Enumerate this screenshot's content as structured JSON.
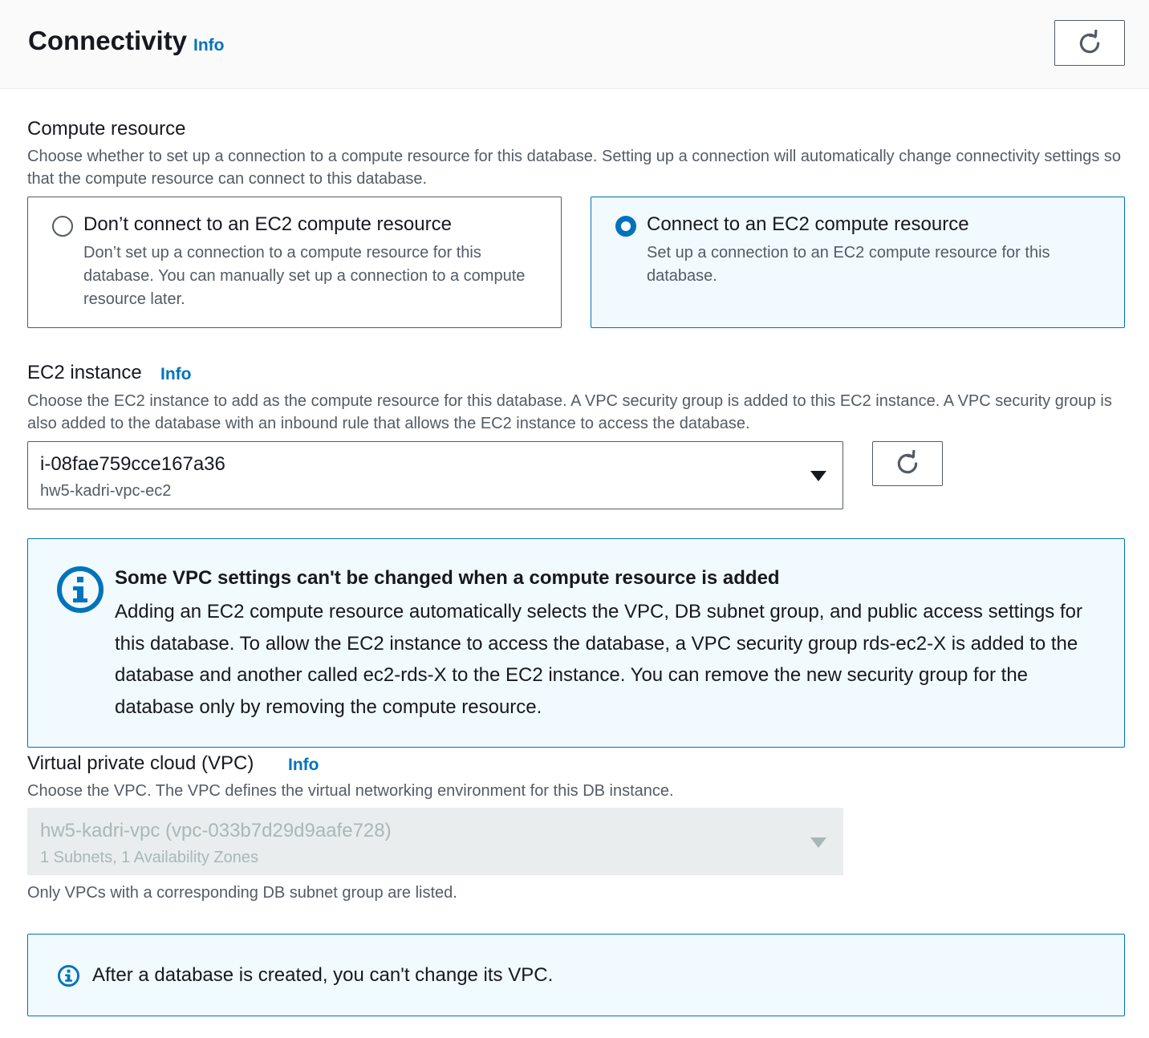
{
  "header": {
    "title": "Connectivity",
    "info_label": "Info"
  },
  "compute_resource": {
    "label": "Compute resource",
    "description": "Choose whether to set up a connection to a compute resource for this database. Setting up a connection will automatically change connectivity settings so that the compute resource can connect to this database.",
    "options": [
      {
        "title": "Don’t connect to an EC2 compute resource",
        "description": "Don’t set up a connection to a compute resource for this database. You can manually set up a connection to a compute resource later.",
        "selected": false
      },
      {
        "title": "Connect to an EC2 compute resource",
        "description": "Set up a connection to an EC2 compute resource for this database.",
        "selected": true
      }
    ]
  },
  "ec2_instance": {
    "label": "EC2 instance",
    "info_label": "Info",
    "description": "Choose the EC2 instance to add as the compute resource for this database. A VPC security group is added to this EC2 instance. A VPC security group is also added to the database with an inbound rule that allows the EC2 instance to access the database.",
    "selected_id": "i-08fae759cce167a36",
    "selected_name": "hw5-kadri-vpc-ec2"
  },
  "vpc_alert": {
    "title": "Some VPC settings can't be changed when a compute resource is added",
    "body": "Adding an EC2 compute resource automatically selects the VPC, DB subnet group, and public access settings for this database. To allow the EC2 instance to access the database, a VPC security group rds-ec2-X is added to the database and another called ec2-rds-X to the EC2 instance. You can remove the new security group for the database only by removing the compute resource."
  },
  "vpc": {
    "label": "Virtual private cloud (VPC)",
    "info_label": "Info",
    "description": "Choose the VPC. The VPC defines the virtual networking environment for this DB instance.",
    "selected": "hw5-kadri-vpc (vpc-033b7d29d9aafe728)",
    "selected_detail": "1 Subnets, 1 Availability Zones",
    "constraint": "Only VPCs with a corresponding DB subnet group are listed."
  },
  "vpc_note": {
    "text": "After a database is created, you can't change its VPC."
  },
  "colors": {
    "accent": "#0073bb",
    "text": "#16191f",
    "secondary_text": "#545b64"
  },
  "icons": {
    "refresh": "refresh-icon",
    "info": "info-circle-icon",
    "dropdown": "caret-down-icon"
  }
}
